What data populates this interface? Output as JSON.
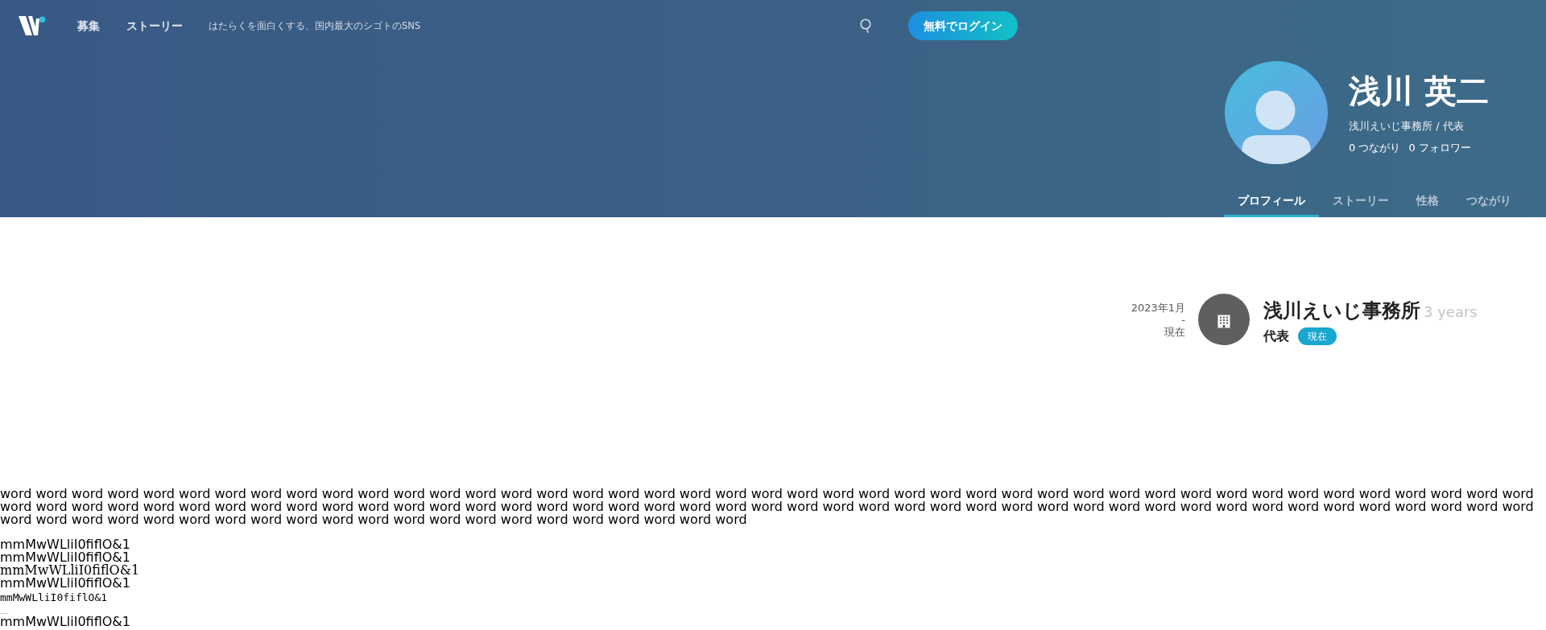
{
  "header": {
    "nav_links": [
      "募集",
      "ストーリー"
    ],
    "tagline": "はたらくを面白くする、国内最大のシゴトのSNS",
    "login_button": "無料でログイン"
  },
  "profile": {
    "name": "浅川 英二",
    "headline": "浅川えいじ事務所 / 代表",
    "stats": [
      "0 つながり",
      "0 フォロワー"
    ],
    "tabs": [
      {
        "label": "プロフィール",
        "selected": true
      },
      {
        "label": "ストーリー",
        "selected": false
      },
      {
        "label": "性格",
        "selected": false
      },
      {
        "label": "つながり",
        "selected": false
      }
    ]
  },
  "career": [
    {
      "period": {
        "start": "2023年1月",
        "separator": "-",
        "end": "現在"
      },
      "company": "浅川えいじ事務所",
      "duration": "3 years",
      "role": "代表",
      "badge": "現在"
    }
  ],
  "font_test": {
    "paragraph": "word word word word word word word word word word word word word word word word word word word word word word word word word word word word word word word word word word word word word word word word word word word word word word word word word word word word word word word word word word word word word word word word word word word word word word word word word word word word word word word word word word word word word word word word word word word word word word word word word word word word word word word word word word word",
    "samples": [
      {
        "kind": "sans",
        "text": "mmMwWLliI0fiflO&1"
      },
      {
        "kind": "sans",
        "text": "mmMwWLliI0fiflO&1"
      },
      {
        "kind": "serif",
        "text": "mmMwWLliI0fiflO&1"
      },
      {
        "kind": "sans",
        "text": "mmMwWLliI0fiflO&1"
      },
      {
        "kind": "mono",
        "text": "mmMwWLliI0fiflO&1"
      },
      {
        "kind": "rule"
      },
      {
        "kind": "sans",
        "text": "mmMwWLliI0fiflO&1"
      }
    ]
  }
}
